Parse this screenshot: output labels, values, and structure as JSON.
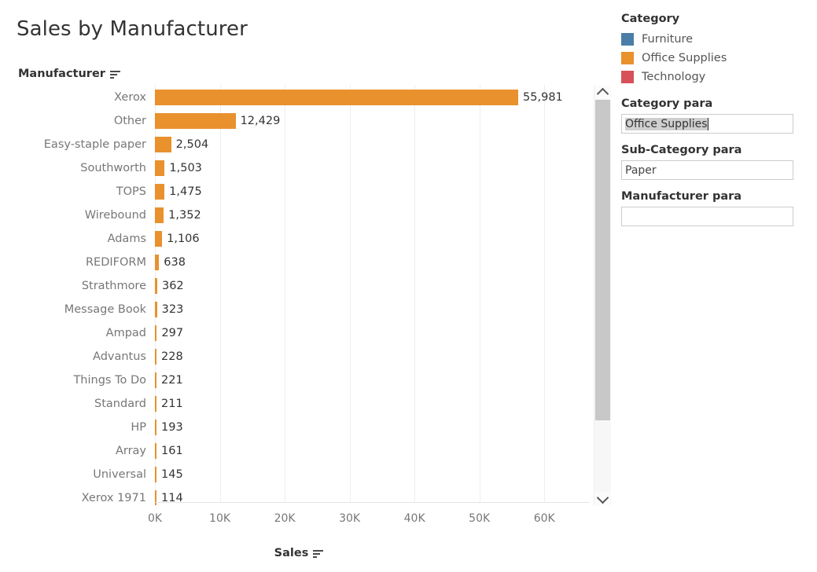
{
  "title": "Sales by Manufacturer",
  "colors": {
    "bar_orange": "#e8912d",
    "furniture_blue": "#4a7ea8",
    "office_supplies_orange": "#e8912d",
    "technology_red": "#d6515a",
    "label_grey": "#777777",
    "value_dark": "#333333"
  },
  "axes": {
    "row_field_label": "Manufacturer",
    "measure_field_label": "Sales",
    "sort_icon": "sort-descending-icon"
  },
  "legend": {
    "title": "Category",
    "items": [
      {
        "label": "Furniture",
        "color": "#4a7ea8"
      },
      {
        "label": "Office Supplies",
        "color": "#e8912d"
      },
      {
        "label": "Technology",
        "color": "#d6515a"
      }
    ]
  },
  "parameters": [
    {
      "title": "Category para",
      "value": "Office Supplies",
      "placeholder": "",
      "selected": true,
      "focused": true
    },
    {
      "title": "Sub-Category para",
      "value": "Paper",
      "placeholder": "",
      "selected": false,
      "focused": false
    },
    {
      "title": "Manufacturer para",
      "value": "",
      "placeholder": "",
      "selected": false,
      "focused": false
    }
  ],
  "scrollbar": {
    "up_icon": "chevron-up-icon",
    "down_icon": "chevron-down-icon",
    "thumb_position_percent": 0,
    "thumb_size_percent": 82
  },
  "chart_data": {
    "type": "bar",
    "orientation": "horizontal",
    "title": "Sales by Manufacturer",
    "xlabel": "Sales",
    "ylabel": "Manufacturer",
    "xlim": [
      0,
      67000
    ],
    "xticks": [
      0,
      10000,
      20000,
      30000,
      40000,
      50000,
      60000
    ],
    "xtick_labels": [
      "0K",
      "10K",
      "20K",
      "30K",
      "40K",
      "50K",
      "60K"
    ],
    "grid": true,
    "legend_position": "right",
    "series_name": "Office Supplies",
    "series_color": "#e8912d",
    "sorted": "descending",
    "categories": [
      "Xerox",
      "Other",
      "Easy-staple paper",
      "Southworth",
      "TOPS",
      "Wirebound",
      "Adams",
      "REDIFORM",
      "Strathmore",
      "Message Book",
      "Ampad",
      "Advantus",
      "Things To Do",
      "Standard",
      "HP",
      "Array",
      "Universal",
      "Xerox 1971"
    ],
    "values": [
      55981,
      12429,
      2504,
      1503,
      1475,
      1352,
      1106,
      638,
      362,
      323,
      297,
      228,
      221,
      211,
      193,
      161,
      145,
      114
    ],
    "value_labels": [
      "55,981",
      "12,429",
      "2,504",
      "1,503",
      "1,475",
      "1,352",
      "1,106",
      "638",
      "362",
      "323",
      "297",
      "228",
      "221",
      "211",
      "193",
      "161",
      "145",
      "114"
    ]
  }
}
